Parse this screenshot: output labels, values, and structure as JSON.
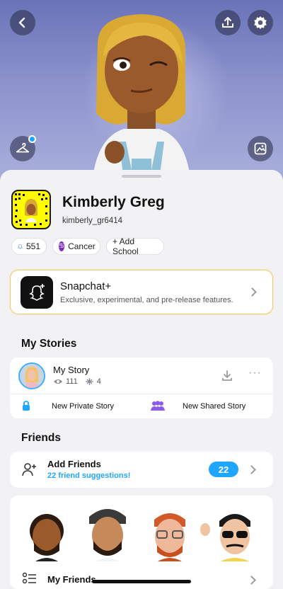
{
  "profile": {
    "display_name": "Kimberly Greg",
    "username": "kimberly_gr6414"
  },
  "chips": {
    "score": "551",
    "zodiac": "Cancer",
    "add_school": "+ Add School"
  },
  "snapchat_plus": {
    "title": "Snapchat+",
    "subtitle": "Exclusive, experimental, and pre-release features."
  },
  "my_stories": {
    "section_title": "My Stories",
    "story_title": "My Story",
    "views": "111",
    "screenshots": "4",
    "new_private": "New Private Story",
    "new_shared": "New Shared Story"
  },
  "friends": {
    "section_title": "Friends",
    "add_friends": "Add Friends",
    "suggestions": "22 friend suggestions!",
    "suggestions_count": "22",
    "my_friends": "My Friends"
  },
  "icons": {
    "back": "chevron-left-icon",
    "upload": "upload-icon",
    "settings": "gear-icon",
    "outfit": "hanger-icon",
    "photo": "photo-icon"
  },
  "colors": {
    "accent_blue": "#1fa6ff",
    "snap_yellow": "#fffc00",
    "gold_border": "#f1cf6c",
    "zodiac_purple": "#7b2fbe"
  }
}
